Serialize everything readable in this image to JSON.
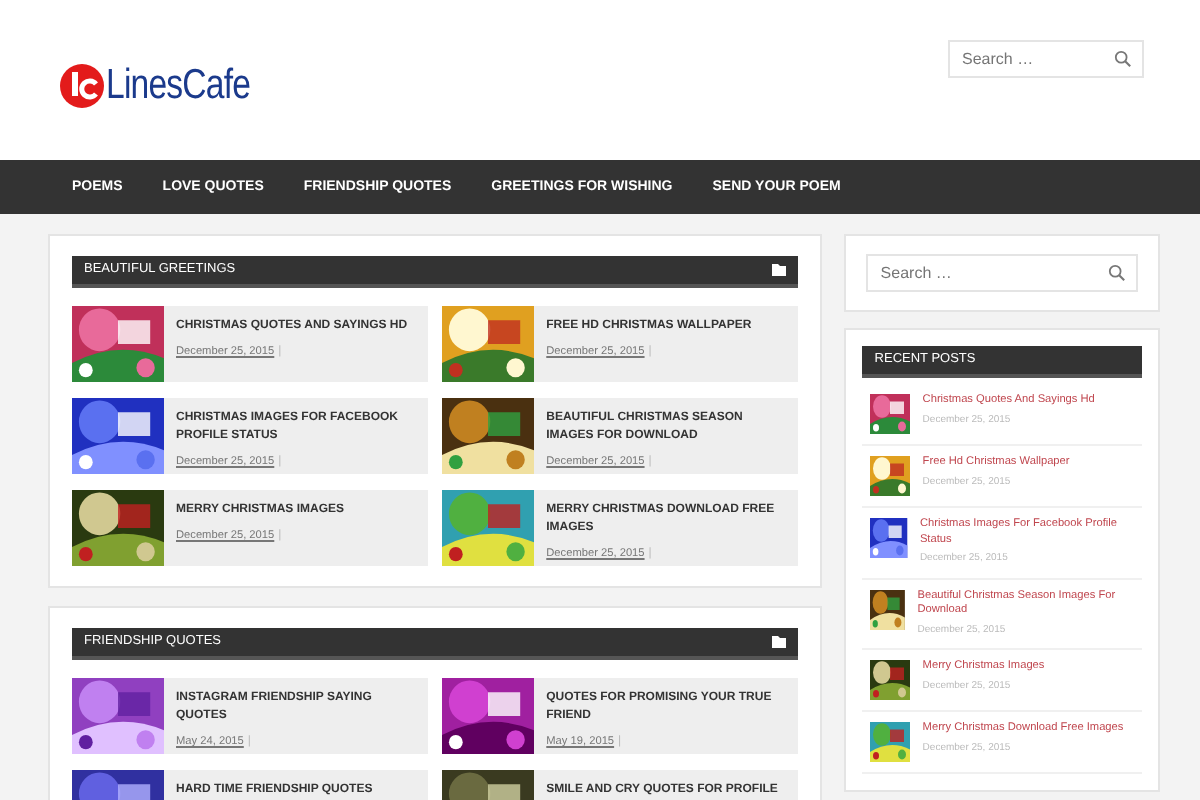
{
  "header": {
    "logo_text": "LinesCafe",
    "search": {
      "placeholder": "Search …"
    }
  },
  "nav": [
    {
      "label": "POEMS"
    },
    {
      "label": "LOVE QUOTES"
    },
    {
      "label": "FRIENDSHIP QUOTES"
    },
    {
      "label": "GREETINGS FOR WISHING"
    },
    {
      "label": "SEND YOUR POEM"
    }
  ],
  "sections": [
    {
      "title": "BEAUTIFUL GREETINGS",
      "posts": [
        {
          "title": "CHRISTMAS QUOTES AND SAYINGS HD",
          "date": "December 25, 2015",
          "separator": "|"
        },
        {
          "title": "FREE HD CHRISTMAS WALLPAPER",
          "date": "December 25, 2015",
          "separator": "|"
        },
        {
          "title": "CHRISTMAS IMAGES FOR FACEBOOK PROFILE STATUS",
          "date": "December 25, 2015",
          "separator": "|"
        },
        {
          "title": "BEAUTIFUL CHRISTMAS SEASON IMAGES FOR DOWNLOAD",
          "date": "December 25, 2015",
          "separator": "|"
        },
        {
          "title": "MERRY CHRISTMAS IMAGES",
          "date": "December 25, 2015",
          "separator": "|"
        },
        {
          "title": "MERRY CHRISTMAS DOWNLOAD FREE IMAGES",
          "date": "December 25, 2015",
          "separator": "|"
        }
      ]
    },
    {
      "title": "FRIENDSHIP QUOTES",
      "posts": [
        {
          "title": "INSTAGRAM FRIENDSHIP SAYING QUOTES",
          "date": "May 24, 2015",
          "separator": "|"
        },
        {
          "title": "QUOTES FOR PROMISING YOUR TRUE FRIEND",
          "date": "May 19, 2015",
          "separator": "|"
        },
        {
          "title": "HARD TIME FRIENDSHIP QUOTES"
        },
        {
          "title": "SMILE AND CRY QUOTES FOR PROFILE"
        }
      ]
    }
  ],
  "sidebar": {
    "search": {
      "placeholder": "Search …"
    },
    "recent_posts": {
      "title": "RECENT POSTS",
      "posts": [
        {
          "title": "Christmas Quotes And Sayings Hd",
          "date": "December 25, 2015"
        },
        {
          "title": "Free Hd Christmas Wallpaper",
          "date": "December 25, 2015"
        },
        {
          "title": "Christmas Images For Facebook Profile Status",
          "date": "December 25, 2015"
        },
        {
          "title": "Beautiful Christmas Season Images For Download",
          "date": "December 25, 2015"
        },
        {
          "title": "Merry Christmas Images",
          "date": "December 25, 2015"
        },
        {
          "title": "Merry Christmas Download Free Images",
          "date": "December 25, 2015"
        }
      ]
    }
  }
}
